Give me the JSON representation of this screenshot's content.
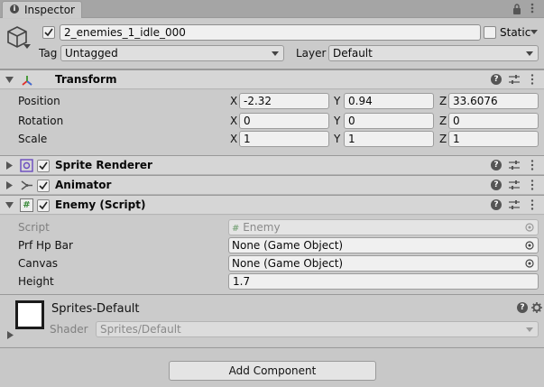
{
  "tab": {
    "label": "Inspector"
  },
  "gameobject": {
    "name": "2_enemies_1_idle_000",
    "active": true,
    "static_label": "Static",
    "tag_label": "Tag",
    "tag_value": "Untagged",
    "layer_label": "Layer",
    "layer_value": "Default"
  },
  "transform": {
    "title": "Transform",
    "position": {
      "label": "Position",
      "x": "-2.32",
      "y": "0.94",
      "z": "33.6076"
    },
    "rotation": {
      "label": "Rotation",
      "x": "0",
      "y": "0",
      "z": "0"
    },
    "scale": {
      "label": "Scale",
      "x": "1",
      "y": "1",
      "z": "1"
    },
    "axis_x": "X",
    "axis_y": "Y",
    "axis_z": "Z"
  },
  "sprite_renderer": {
    "title": "Sprite Renderer",
    "enabled": true
  },
  "animator": {
    "title": "Animator",
    "enabled": true
  },
  "enemy_script": {
    "title": "Enemy (Script)",
    "enabled": true,
    "script_label": "Script",
    "script_value": "Enemy",
    "prf_hp_bar_label": "Prf Hp Bar",
    "prf_hp_bar_value": "None (Game Object)",
    "canvas_label": "Canvas",
    "canvas_value": "None (Game Object)",
    "height_label": "Height",
    "height_value": "1.7"
  },
  "material": {
    "name": "Sprites-Default",
    "shader_label": "Shader",
    "shader_value": "Sprites/Default"
  },
  "add_component_label": "Add Component",
  "icon_glyphs": {
    "help": "?",
    "script_hash": "#"
  },
  "colors": {
    "transform_icon": "#e0312a",
    "accent_green": "#3a8a3a"
  }
}
